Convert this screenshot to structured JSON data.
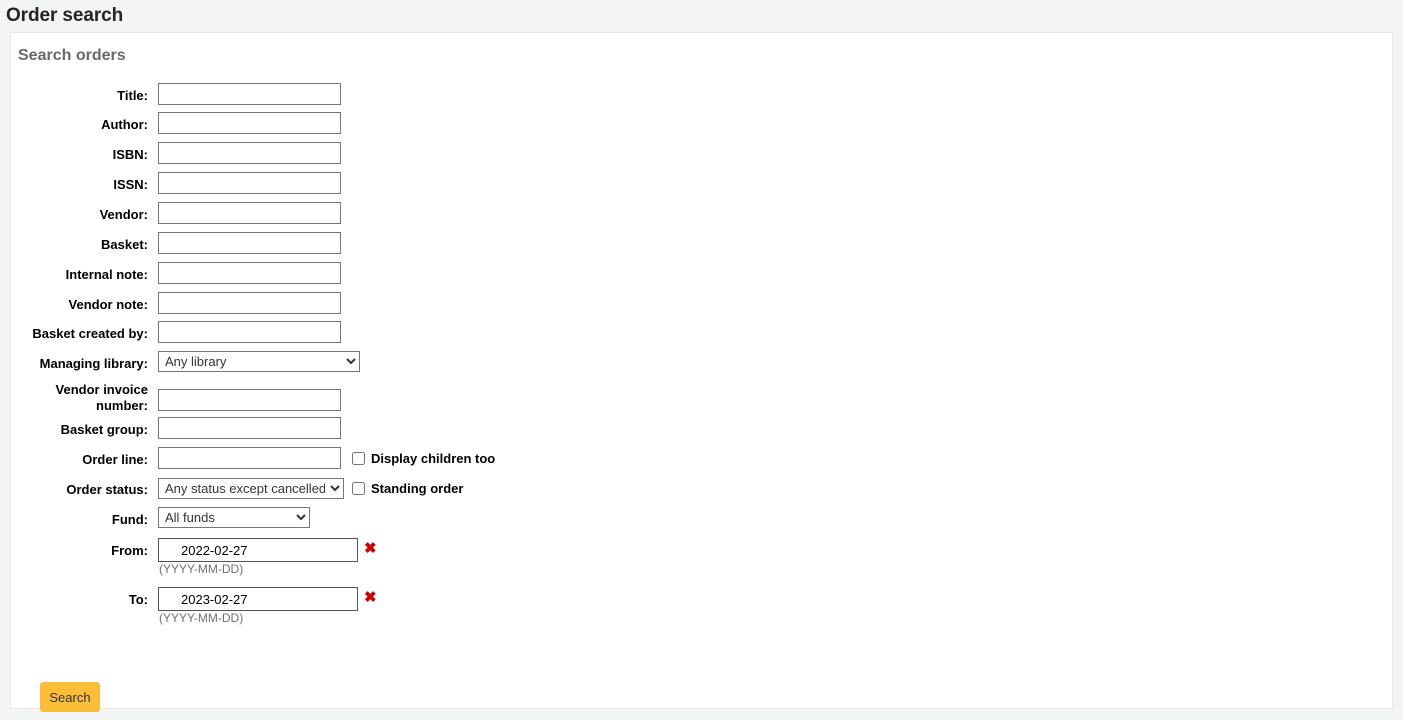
{
  "page": {
    "title": "Order search",
    "legend": "Search orders"
  },
  "fields": {
    "title": {
      "label": "Title:",
      "value": "",
      "placeholder": ""
    },
    "author": {
      "label": "Author:",
      "value": "",
      "placeholder": ""
    },
    "isbn": {
      "label": "ISBN:",
      "value": "",
      "placeholder": ""
    },
    "issn": {
      "label": "ISSN:",
      "value": "",
      "placeholder": ""
    },
    "vendor": {
      "label": "Vendor:",
      "value": "",
      "placeholder": ""
    },
    "basket": {
      "label": "Basket:",
      "value": "",
      "placeholder": ""
    },
    "internal_note": {
      "label": "Internal note:",
      "value": "",
      "placeholder": ""
    },
    "vendor_note": {
      "label": "Vendor note:",
      "value": "",
      "placeholder": ""
    },
    "basket_created_by": {
      "label": "Basket created by:",
      "value": "",
      "placeholder": ""
    },
    "managing_library": {
      "label": "Managing library:",
      "value": "Any library",
      "options": [
        "Any library"
      ]
    },
    "vendor_invoice_number": {
      "label": "Vendor invoice number:",
      "value": "",
      "placeholder": ""
    },
    "basket_group": {
      "label": "Basket group:",
      "value": "",
      "placeholder": ""
    },
    "order_line": {
      "label": "Order line:",
      "value": "",
      "placeholder": ""
    },
    "display_children": {
      "label": "Display children too",
      "checked": false
    },
    "order_status": {
      "label": "Order status:",
      "value": "Any status except cancelled",
      "options": [
        "Any status except cancelled"
      ]
    },
    "standing_order": {
      "label": "Standing order",
      "checked": false
    },
    "fund": {
      "label": "Fund:",
      "value": "All funds",
      "options": [
        "All funds"
      ]
    },
    "date_from": {
      "label": "From:",
      "value": "2022-02-27",
      "hint": "(YYYY-MM-DD)",
      "clear_icon": "clear-date-icon",
      "clear_glyph": "✖"
    },
    "date_to": {
      "label": "To:",
      "value": "2023-02-27",
      "hint": "(YYYY-MM-DD)",
      "clear_icon": "clear-date-icon",
      "clear_glyph": "✖"
    }
  },
  "actions": {
    "search_label": "Search"
  },
  "colors": {
    "page_background": "#f3f4f4",
    "panel_background": "#ffffff",
    "legend_text": "#696969",
    "title_text": "#242424",
    "button_background": "#fcbe39",
    "button_text": "#333333",
    "clear_icon": "#cc0000",
    "hint_text": "#727272",
    "input_border": "#767676"
  }
}
